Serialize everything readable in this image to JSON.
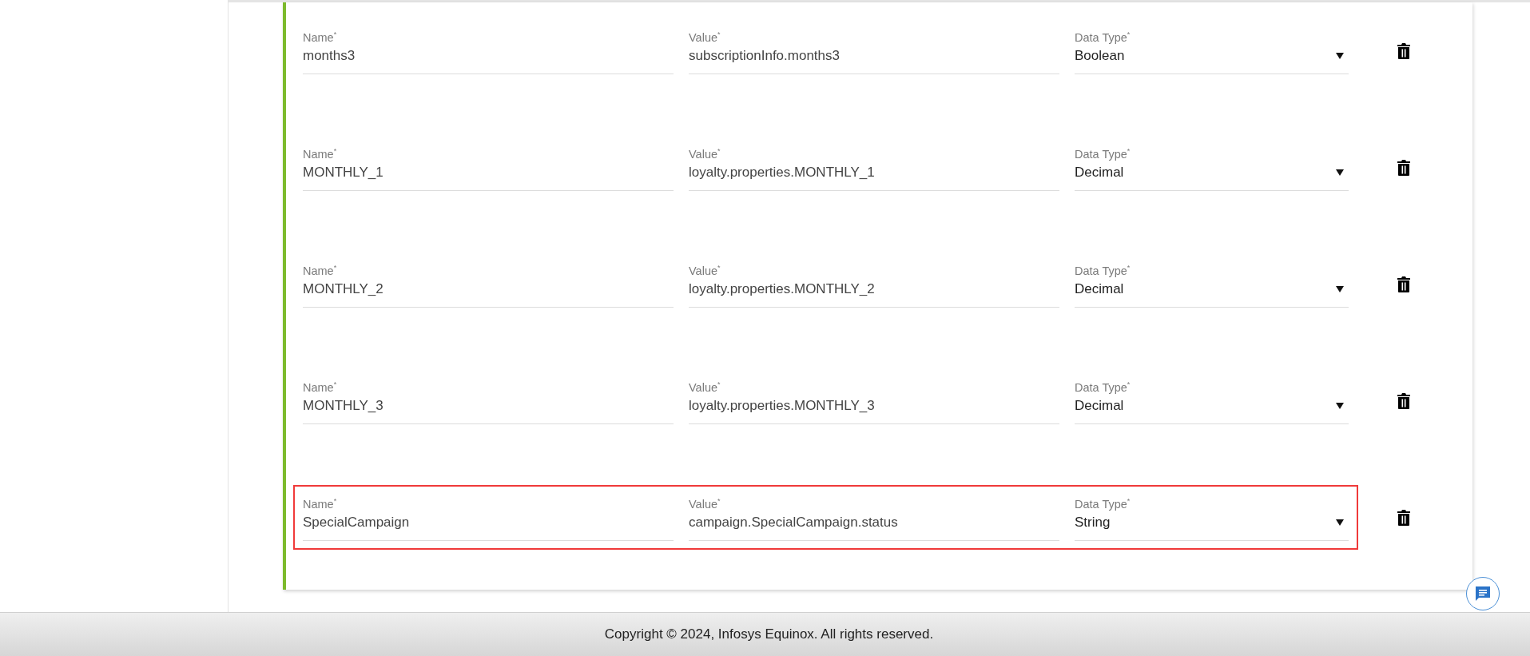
{
  "rows": [
    {
      "name": {
        "label": "Name$^{*}$",
        "value": "months3"
      },
      "value": {
        "label": "Value$^{*}$",
        "value": "subscriptionInfo.months3"
      },
      "data_type": {
        "label": "Data Type$^{*}$",
        "value": "Boolean"
      },
      "highlighted": false
    },
    {
      "name": {
        "label": "Name$^{*}$",
        "value": "MONTHLY_1"
      },
      "value": {
        "label": "Value$^{*}$",
        "value": "loyalty.properties.MONTHLY_1"
      },
      "data_type": {
        "label": "Data Type$^{*}$",
        "value": "Decimal"
      },
      "highlighted": false
    },
    {
      "name": {
        "label": "Name$^{*}$",
        "value": "MONTHLY_2"
      },
      "value": {
        "label": "Value$^{*}$",
        "value": "loyalty.properties.MONTHLY_2"
      },
      "data_type": {
        "label": "Data Type$^{*}$",
        "value": "Decimal"
      },
      "highlighted": false
    },
    {
      "name": {
        "label": "Name$^{*}$",
        "value": "MONTHLY_3"
      },
      "value": {
        "label": "Value$^{*}$",
        "value": "loyalty.properties.MONTHLY_3"
      },
      "data_type": {
        "label": "Data Type$^{*}$",
        "value": "Decimal"
      },
      "highlighted": false
    },
    {
      "name": {
        "label": "Name$^{*}$",
        "value": "SpecialCampaign"
      },
      "value": {
        "label": "Value$^{*}$",
        "value": "campaign.SpecialCampaign.status"
      },
      "data_type": {
        "label": "Data Type$^{*}$",
        "value": "String"
      },
      "highlighted": true
    }
  ],
  "footer": {
    "copyright": "Copyright © 2024, Infosys Equinox. All rights reserved."
  }
}
